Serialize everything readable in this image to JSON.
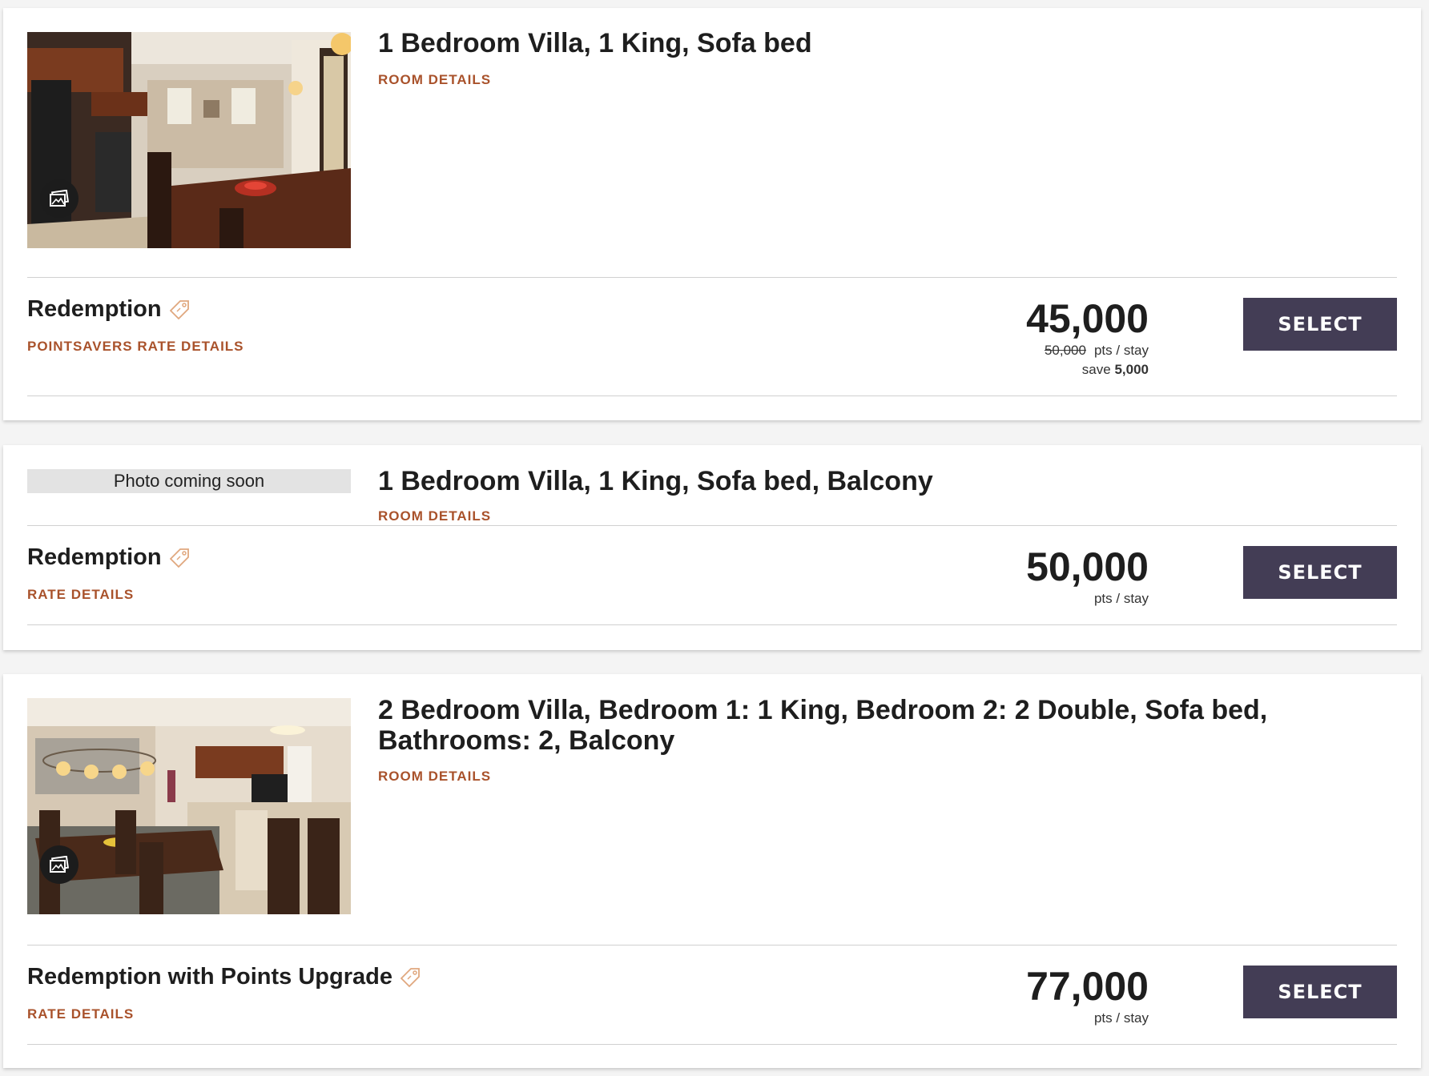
{
  "rooms": [
    {
      "title": "1 Bedroom Villa, 1 King, Sofa bed",
      "details_link": "ROOM DETAILS",
      "photo": "kitchen-dining-photo",
      "gallery_icon": "gallery-icon",
      "rate": {
        "name": "Redemption",
        "tag_icon": "tag-icon",
        "details_link": "POINTSAVERS RATE DETAILS",
        "price": "45,000",
        "old_price": "50,000",
        "unit": "pts / stay",
        "save_label": "save",
        "save_amount": "5,000",
        "select_label": "SELECT"
      }
    },
    {
      "title": "1 Bedroom Villa, 1 King, Sofa bed, Balcony",
      "details_link": "ROOM DETAILS",
      "photo_placeholder": "Photo coming soon",
      "rate": {
        "name": "Redemption",
        "tag_icon": "tag-icon",
        "details_link": "RATE DETAILS",
        "price": "50,000",
        "unit": "pts / stay",
        "select_label": "SELECT"
      }
    },
    {
      "title": "2 Bedroom Villa, Bedroom 1: 1 King, Bedroom 2: 2 Double, Sofa bed, Bathrooms: 2, Balcony",
      "details_link": "ROOM DETAILS",
      "photo": "dining-kitchen-photo",
      "gallery_icon": "gallery-icon",
      "rate": {
        "name": "Redemption with Points Upgrade",
        "tag_icon": "tag-icon",
        "details_link": "RATE DETAILS",
        "price": "77,000",
        "unit": "pts / stay",
        "select_label": "SELECT"
      }
    }
  ],
  "colors": {
    "accent": "#a9522b",
    "button": "#433d55",
    "tag": "#e0a77e"
  }
}
